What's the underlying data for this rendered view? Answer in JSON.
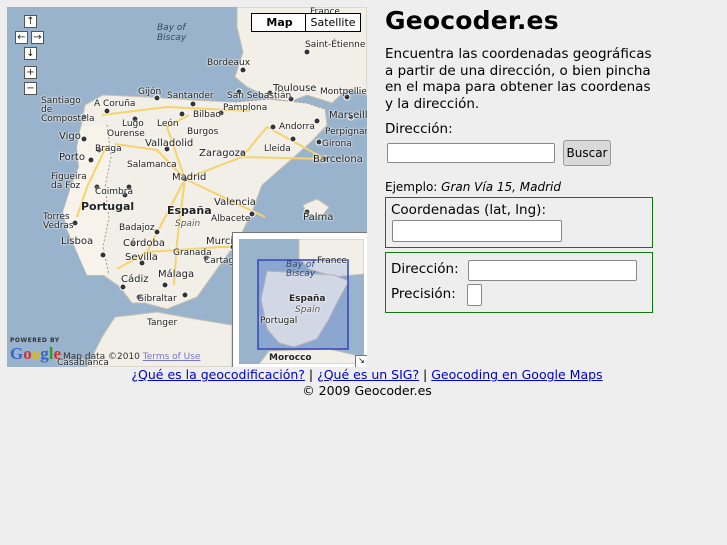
{
  "map": {
    "type_buttons": {
      "map": "Map",
      "satellite": "Satellite"
    },
    "nav_glyphs": {
      "up": "↑",
      "left": "←",
      "right": "→",
      "down": "↓",
      "zoom_in": "+",
      "zoom_out": "−"
    },
    "powered_by": "POWERED BY",
    "logo": "Google",
    "copyright_text": "Map data ©2010 ",
    "terms_link": "Terms of Use",
    "seas": {
      "biscay": "Bay of\nBiscay"
    },
    "cities": {
      "france": "France",
      "st_etienne": "Saint-Étienne",
      "bordeaux": "Bordeaux",
      "toulouse": "Toulouse",
      "montpellier": "Montpellier",
      "marseille": "Marseille",
      "perpignan": "Perpignan",
      "san_sebastian": "San Sebastián",
      "santander": "Santander",
      "gijon": "Gijón",
      "a_coruna": "A Coruña",
      "santiago": "Santiago de Compostela",
      "lugo": "Lugo",
      "bilbao": "Bilbao",
      "vigo": "Vigo",
      "ourense": "Ourense",
      "leon": "León",
      "burgos": "Burgos",
      "pamplona": "Pamplona",
      "andorra": "Andorra",
      "girona": "Girona",
      "porto": "Porto",
      "braga": "Braga",
      "valladolid": "Valladolid",
      "zaragoza": "Zaragoza",
      "lleida": "Lleida",
      "barcelona": "Barcelona",
      "salamanca": "Salamanca",
      "figueira": "Figueira da Foz",
      "coimbra": "Coimbra",
      "madrid": "Madrid",
      "portugal": "Portugal",
      "espana": "España",
      "spain": "Spain",
      "valencia": "Valencia",
      "palma": "Palma",
      "torres_vedras": "Torres Vedras",
      "badajoz": "Badajoz",
      "albacete": "Albacete",
      "lisboa": "Lisboa",
      "cordoba": "Córdoba",
      "murcia": "Murci",
      "sevilla": "Sevilla",
      "granada": "Granada",
      "cartagena": "Cartage",
      "cadiz": "Cádiz",
      "malaga": "Málaga",
      "gibraltar": "Gibraltar",
      "tangier": "Tanger",
      "casablanca": "Casablanca"
    },
    "overview": {
      "france": "France",
      "biscay": "Bay of\nBiscay",
      "espana": "España",
      "spain": "Spain",
      "portugal": "Portugal",
      "morocco": "Morocco",
      "corner": "↘"
    }
  },
  "header": {
    "title": "Geocoder.es"
  },
  "intro": "Encuentra las coordenadas geográficas a partir de una dirección, o bien pincha en el mapa para obtener las coordenas y la dirección.",
  "search": {
    "label": "Dirección:",
    "value": "",
    "button": "Buscar",
    "example_prefix": "Ejemplo: ",
    "example_value": "Gran Vía 15, Madrid"
  },
  "coords": {
    "label": "Coordenadas (lat, lng):",
    "value": ""
  },
  "result": {
    "address_label": "Dirección:",
    "address_value": "",
    "precision_label": "Precisión:",
    "precision_value": ""
  },
  "footer": {
    "links": [
      "¿Qué es la geocodificación?",
      "¿Qué es un SIG?",
      "Geocoding en Google Maps"
    ],
    "separator": " | ",
    "copyright": "© 2009 Geocoder.es"
  },
  "colors": {
    "sea": "#99b3cc",
    "land": "#f2efe9",
    "link": "#0000cc",
    "box_border": "#117711",
    "road": "#f5d36b"
  }
}
